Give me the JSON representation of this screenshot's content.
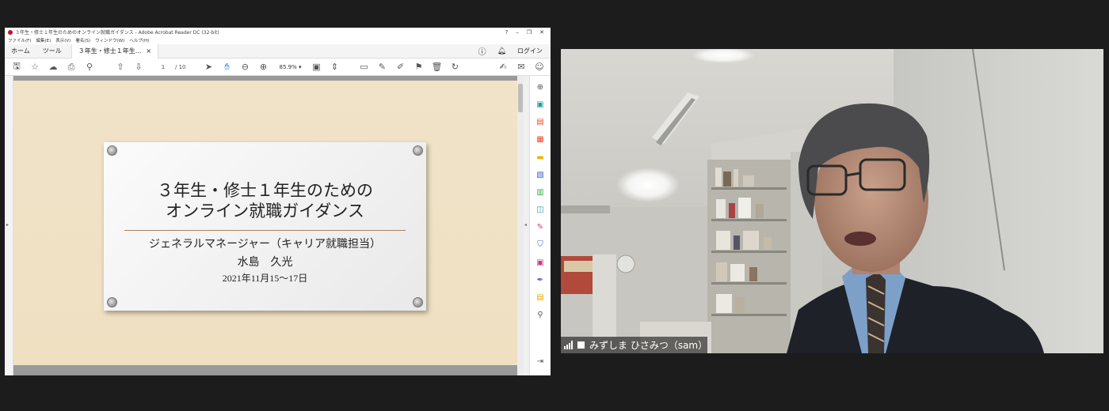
{
  "acrobat": {
    "window_title": "３年生・修士１年生のためのオンライン就職ガイダンス - Adobe Acrobat Reader DC (32-bit)",
    "window_controls": [
      "?",
      "–",
      "❐",
      "✕"
    ],
    "menu": [
      "ファイル(F)",
      "編集(E)",
      "表示(V)",
      "署名(S)",
      "ウィンドウ(W)",
      "ヘルプ(H)"
    ],
    "tabs": {
      "home": "ホーム",
      "tools": "ツール",
      "document": "３年生・修士１年生...",
      "close": "×"
    },
    "login_label": "ログイン",
    "page_current": "1",
    "page_total": "/ 10",
    "zoom": "85.9%",
    "toolbar_icons": [
      "save-icon",
      "bookmark-star-icon",
      "upload-icon",
      "print-icon",
      "zoom-out-search-icon",
      "page-up-icon",
      "page-down-icon",
      "select-cursor-icon",
      "hand-icon",
      "zoom-out-icon",
      "zoom-in-icon",
      "fit-page-icon",
      "scroll-mode-icon",
      "comment-icon",
      "highlight-pen-icon",
      "draw-icon",
      "stamp-icon",
      "delete-icon",
      "rotate-icon"
    ],
    "toolbar_right_icons": [
      "sign-icon",
      "mail-icon",
      "account-icon"
    ]
  },
  "slide": {
    "title_line1": "３年生・修士１年生のための",
    "title_line2": "オンライン就職ガイダンス",
    "role": "ジェネラルマネージャー（キャリア就職担当）",
    "name": "水島　久光",
    "date": "2021年11月15～17日"
  },
  "right_pane_icons": [
    {
      "name": "zoom-search-icon",
      "color": "#555555",
      "glyph": "⊕"
    },
    {
      "name": "export-pdf-icon",
      "color": "#1aa39a",
      "glyph": "▣"
    },
    {
      "name": "create-pdf-icon",
      "color": "#e84e2a",
      "glyph": "▤"
    },
    {
      "name": "edit-pdf-icon",
      "color": "#e84e2a",
      "glyph": "▦"
    },
    {
      "name": "comment-tool-icon",
      "color": "#f2b300",
      "glyph": "▬"
    },
    {
      "name": "combine-files-icon",
      "color": "#3b63c4",
      "glyph": "▧"
    },
    {
      "name": "organize-pages-icon",
      "color": "#3fae3f",
      "glyph": "▥"
    },
    {
      "name": "scan-icon",
      "color": "#19a0b0",
      "glyph": "◫"
    },
    {
      "name": "fill-sign-icon",
      "color": "#d83a7a",
      "glyph": "✎"
    },
    {
      "name": "protect-icon",
      "color": "#3b5fc0",
      "glyph": "⛉"
    },
    {
      "name": "compress-icon",
      "color": "#c83a7a",
      "glyph": "▣"
    },
    {
      "name": "redact-icon",
      "color": "#6a4ac0",
      "glyph": "✒"
    },
    {
      "name": "prepare-form-icon",
      "color": "#e8a800",
      "glyph": "▤"
    },
    {
      "name": "more-tools-icon",
      "color": "#555555",
      "glyph": "⚲"
    },
    {
      "name": "collapse-pane-icon",
      "color": "#555555",
      "glyph": "⇥"
    }
  ],
  "video": {
    "participant": "みずしま ひさみつ（sam）"
  }
}
